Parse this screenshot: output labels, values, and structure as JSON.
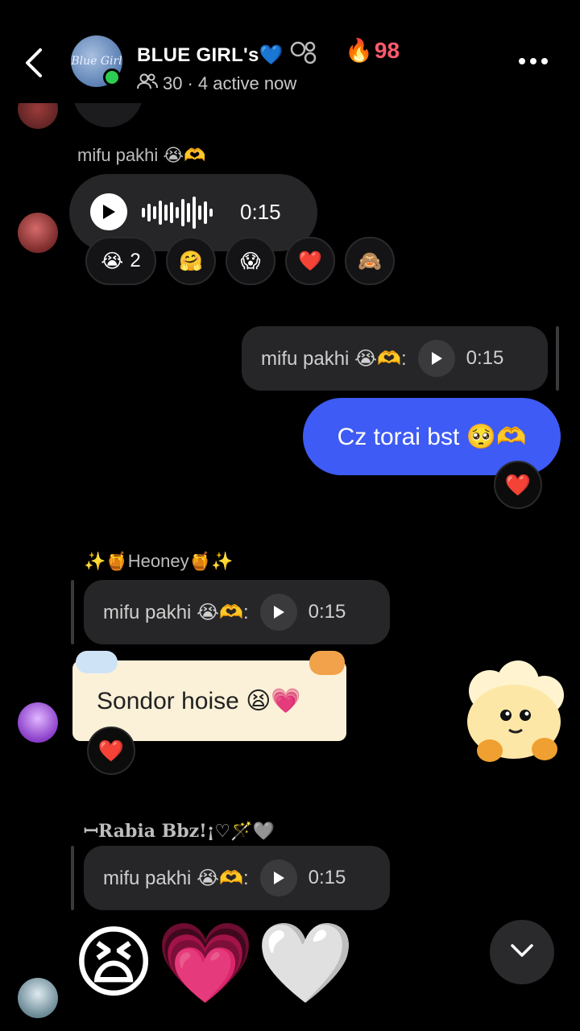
{
  "header": {
    "group_name": "BLUE GIRL's💙",
    "avatar_text": "Blue Girl",
    "member_count": "30",
    "active_text": "· 4 active now",
    "streak": "98"
  },
  "messages": {
    "voice1": {
      "sender": "mifu pakhi 😭🫶",
      "duration": "0:15",
      "reactions": [
        {
          "emoji": "😭",
          "count": "2"
        },
        {
          "emoji": "🤗",
          "count": ""
        },
        {
          "emoji": "😱",
          "count": ""
        },
        {
          "emoji": "❤️",
          "count": ""
        },
        {
          "emoji": "🙈",
          "count": ""
        }
      ]
    },
    "my_reply": {
      "quote": "mifu pakhi 😭🫶:",
      "quote_duration": "0:15",
      "text": "Cz torai bst 🥺🫶",
      "reaction": "❤️"
    },
    "heoney": {
      "sender": "✨🍯Heoney🍯✨",
      "quote": "mifu pakhi 😭🫶:",
      "quote_duration": "0:15",
      "text": "Sondor hoise 😫💗",
      "reaction": "❤️"
    },
    "rabia": {
      "sender": "ꟷRabia Bbz!¡♡🪄🩶",
      "quote": "mifu pakhi 😭🫶:",
      "quote_duration": "0:15",
      "big_emojis": "😫💗🤍"
    }
  },
  "colors": {
    "accent_blue": "#3e5bf5",
    "online_green": "#2ecc52",
    "streak_red": "#ff5a6e"
  }
}
